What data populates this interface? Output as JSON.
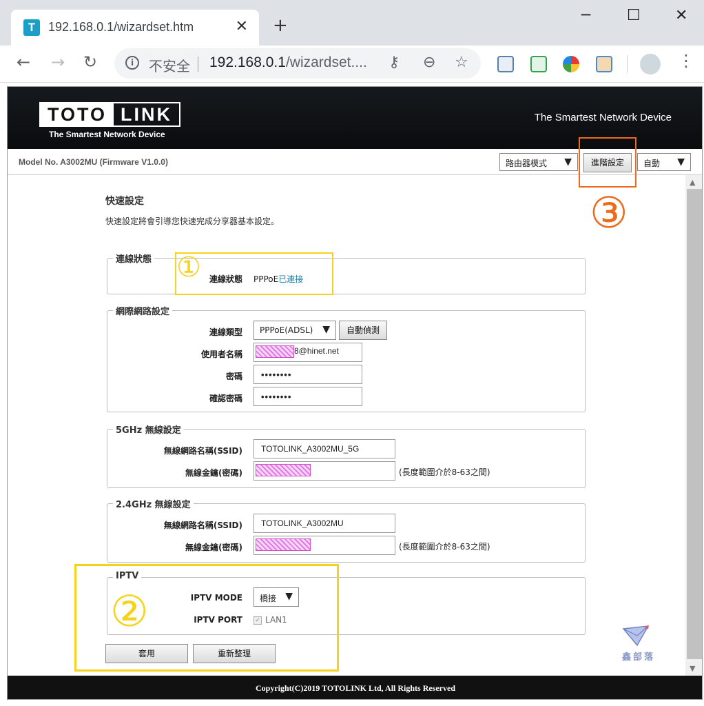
{
  "browser": {
    "tab_title": "192.168.0.1/wizardset.htm",
    "favicon_letter": "T",
    "close_glyph": "✕",
    "newtab_glyph": "+",
    "insecure_label": "不安全",
    "url_host": "192.168.0.1",
    "url_rest": "/wizardset....",
    "window_buttons": [
      "─",
      "☐",
      "✕"
    ]
  },
  "router": {
    "logo_left": "TOTO",
    "logo_right": "LINK",
    "logo_tagline": "The Smartest Network Device",
    "header_slogan": "The Smartest Network Device",
    "model_text": "Model No. A3002MU (Firmware V1.0.0)",
    "mode_select": "路由器模式",
    "advanced_button": "進階設定",
    "language_select": "自動",
    "page_title": "快速設定",
    "page_subtitle": "快速設定將會引導您快速完成分享器基本設定。",
    "connection_status": {
      "legend": "連線狀態",
      "label": "連線狀態",
      "value_prefix": "PPPoE",
      "value_link": "已連接"
    },
    "internet": {
      "legend": "網際網路設定",
      "type_label": "連線類型",
      "type_value": "PPPoE(ADSL)",
      "detect_button": "自動偵測",
      "username_label": "使用者名稱",
      "username_suffix": "8@hinet.net",
      "password_label": "密碼",
      "password_value": "••••••••",
      "confirm_label": "確認密碼",
      "confirm_value": "••••••••"
    },
    "wifi5g": {
      "legend": "5GHz 無線設定",
      "ssid_label": "無線網路名稱(SSID)",
      "ssid_value": "TOTOLINK_A3002MU_5G",
      "key_label": "無線金鑰(密碼)",
      "key_hint": "(長度範圍介於8-63之間)"
    },
    "wifi24g": {
      "legend": "2.4GHz 無線設定",
      "ssid_label": "無線網路名稱(SSID)",
      "ssid_value": "TOTOLINK_A3002MU",
      "key_label": "無線金鑰(密碼)",
      "key_hint": "(長度範圍介於8-63之間)"
    },
    "iptv": {
      "legend": "IPTV",
      "mode_label": "IPTV MODE",
      "mode_value": "橋接",
      "port_label": "IPTV PORT",
      "port_option": "LAN1"
    },
    "apply_button": "套用",
    "reset_button": "重新整理",
    "footer": "Copyright(C)2019 TOTOLINK Ltd, All Rights Reserved"
  },
  "annotations": {
    "marker1": "①",
    "marker2": "②",
    "marker3": "③",
    "yellow": "#f5d31c",
    "orange": "#ec6a1a"
  },
  "watermark": "鑫部落"
}
